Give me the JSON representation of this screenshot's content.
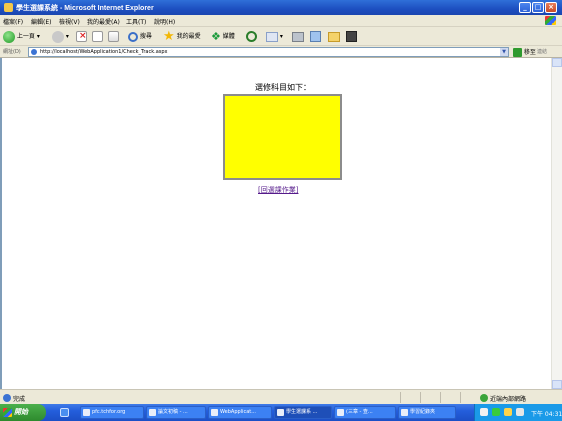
{
  "window": {
    "title": "學生選課系統 - Microsoft Internet Explorer"
  },
  "menubar": {
    "items": [
      "檔案(F)",
      "編輯(E)",
      "檢視(V)",
      "我的最愛(A)",
      "工具(T)",
      "說明(H)"
    ]
  },
  "toolbar": {
    "back_label": "上一頁",
    "search_label": "搜尋",
    "favorites_label": "我的最愛",
    "media_label": "媒體"
  },
  "address": {
    "label": "網址(D)",
    "url": "http://localhost/WebApplication1/Check_Track.aspx",
    "go_label": "移至",
    "links_label": "連結"
  },
  "content": {
    "heading": "選修科目如下：",
    "box_color": "#ffff00",
    "link_label": "[回選課作業]"
  },
  "statusbar": {
    "status_text": "完成",
    "zone_text": "近端內部網路"
  },
  "taskbar": {
    "start_label": "開始",
    "tasks": [
      "pfc.tchfor.org",
      "論文初稿 - ...",
      "WebApplicat...",
      "學生選課系 ...",
      "(三章 - 查...",
      "學習紀錄夾"
    ],
    "clock": "下午 04:31"
  }
}
